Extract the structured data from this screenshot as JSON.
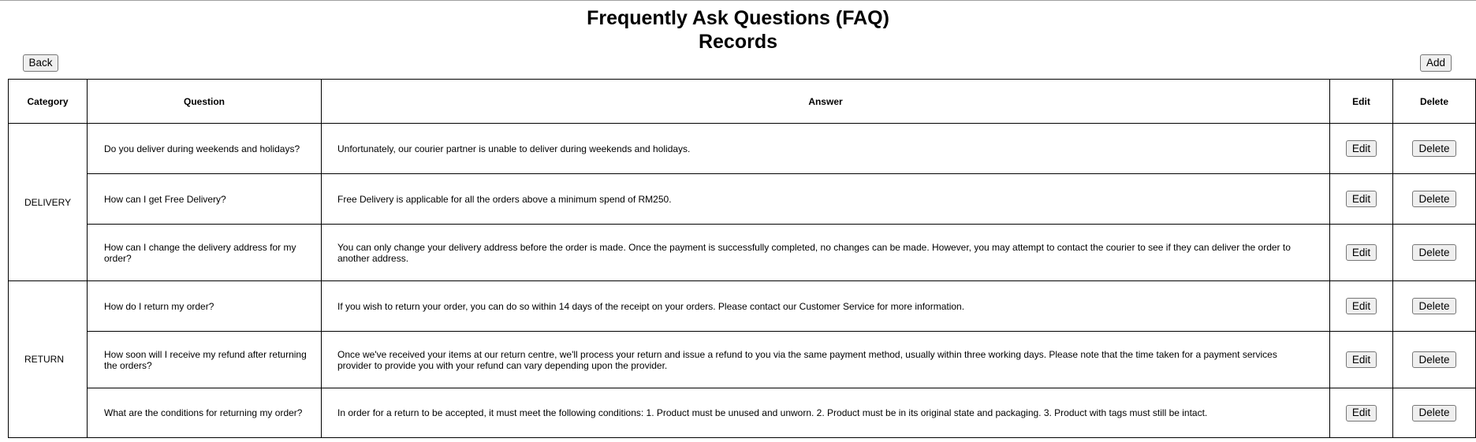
{
  "header": {
    "title_line1": "Frequently Ask Questions (FAQ)",
    "title_line2": "Records"
  },
  "toolbar": {
    "back_label": "Back",
    "add_label": "Add"
  },
  "table": {
    "columns": [
      "Category",
      "Question",
      "Answer",
      "Edit",
      "Delete"
    ],
    "groups": [
      {
        "category": "DELIVERY",
        "rows": [
          {
            "question": "Do you deliver during weekends and holidays?",
            "answer": "Unfortunately, our courier partner is unable to deliver during weekends and holidays.",
            "edit_label": "Edit",
            "delete_label": "Delete"
          },
          {
            "question": "How can I get Free Delivery?",
            "answer": "Free Delivery is applicable for all the orders above a minimum spend of RM250.",
            "edit_label": "Edit",
            "delete_label": "Delete"
          },
          {
            "question": "How can I change the delivery address for my order?",
            "answer": "You can only change your delivery address before the order is made. Once the payment is successfully completed, no changes can be made. However, you may attempt to contact the courier to see if they can deliver the order to another address.",
            "edit_label": "Edit",
            "delete_label": "Delete"
          }
        ]
      },
      {
        "category": "RETURN",
        "rows": [
          {
            "question": "How do I return my order?",
            "answer": "If you wish to return your order, you can do so within 14 days of the receipt on your orders. Please contact our Customer Service for more information.",
            "edit_label": "Edit",
            "delete_label": "Delete"
          },
          {
            "question": "How soon will I receive my refund after returning the orders?",
            "answer": "Once we've received your items at our return centre, we'll process your return and issue a refund to you via the same payment method, usually within three working days. Please note that the time taken for a payment services provider to provide you with your refund can vary depending upon the provider.",
            "edit_label": "Edit",
            "delete_label": "Delete"
          },
          {
            "question": "What are the conditions for returning my order?",
            "answer": "In order for a return to be accepted, it must meet the following conditions: 1. Product must be unused and unworn. 2. Product must be in its original state and packaging. 3. Product with tags must still be intact.",
            "edit_label": "Edit",
            "delete_label": "Delete"
          }
        ]
      }
    ]
  }
}
